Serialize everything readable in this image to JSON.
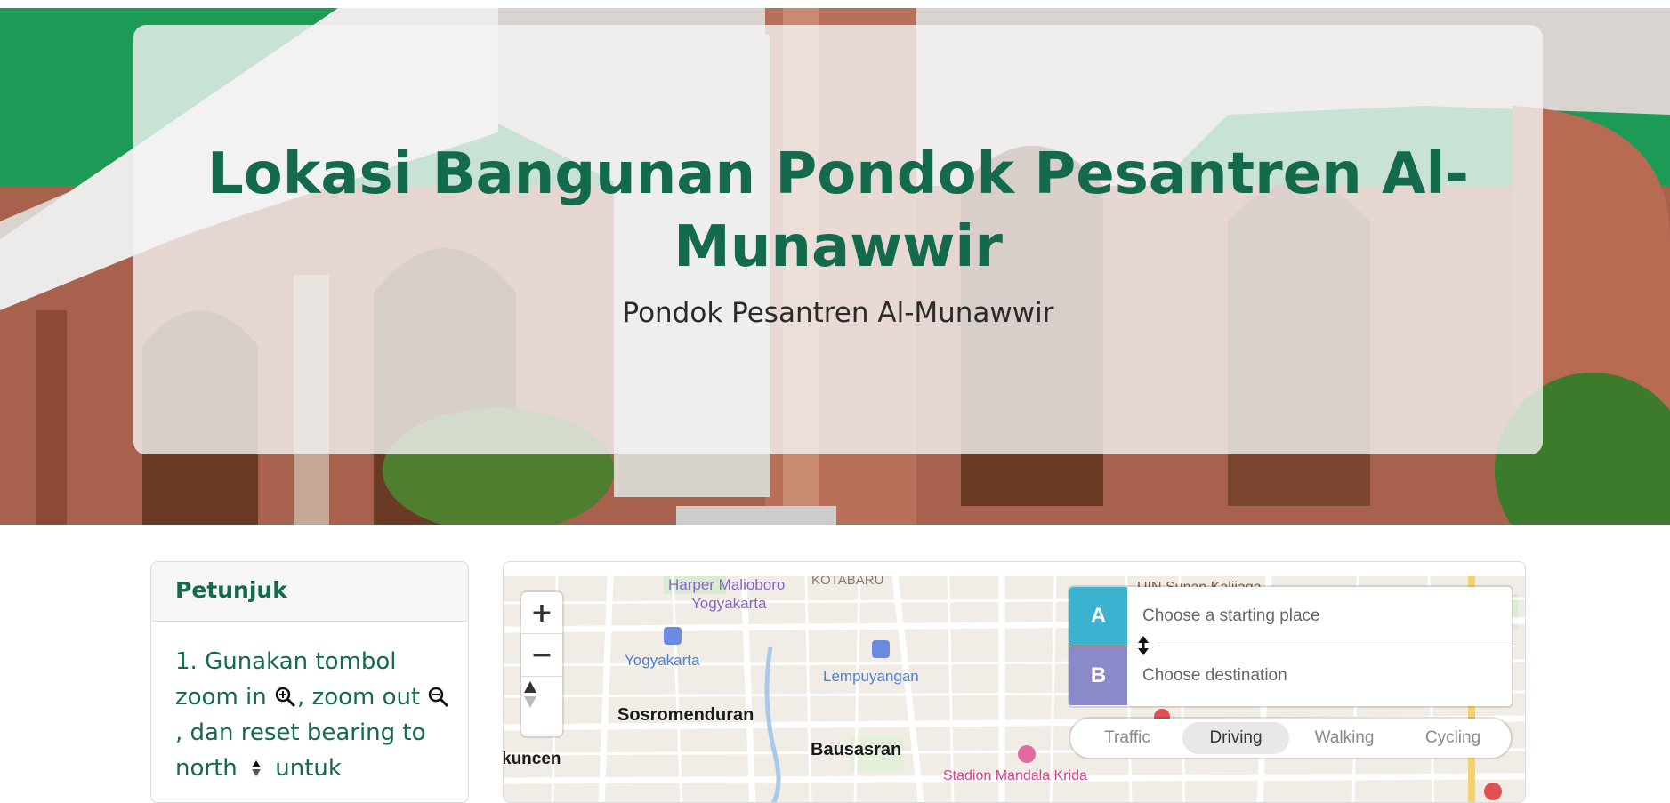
{
  "hero": {
    "title": "Lokasi Bangunan Pondok Pesantren Al-Munawwir",
    "subtitle": "Pondok Pesantren Al-Munawwir"
  },
  "instructions": {
    "title": "Petunjuk",
    "step1_text_a": "1. Gunakan tombol zoom in",
    "step1_text_b": ", zoom out",
    "step1_text_c": ", dan reset bearing to north",
    "step1_text_d": " untuk",
    "icons": [
      "zoom-in-icon",
      "zoom-out-icon",
      "bearing-icon"
    ]
  },
  "map": {
    "labels": {
      "harper": "Harper Malioboro",
      "yogyakarta_hotel": "Yogyakarta",
      "kotabaru": "KOTABARU",
      "uin": "UIN Sunan Kalijaga",
      "station_yogyakarta": "Yogyakarta",
      "station_lempuyangan": "Lempuyangan",
      "sosromenduran": "Sosromenduran",
      "bausasran": "Bausasran",
      "kuncen": "kuncen",
      "stadion": "Stadion Mandala Krida"
    },
    "zoom_in_symbol": "+",
    "zoom_out_symbol": "−"
  },
  "directions": {
    "origin_badge": "A",
    "destination_badge": "B",
    "origin_placeholder": "Choose a starting place",
    "destination_placeholder": "Choose destination",
    "origin_color": "#3bb2d0",
    "destination_color": "#8a8acb",
    "modes": [
      "Traffic",
      "Driving",
      "Walking",
      "Cycling"
    ],
    "active_mode": "Driving"
  },
  "colors": {
    "brand_green": "#136a4d",
    "hero_green": "#1d9a55"
  }
}
